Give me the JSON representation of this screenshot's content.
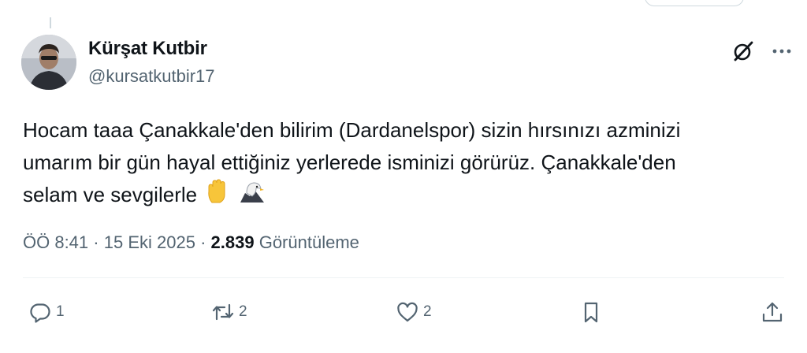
{
  "author": {
    "display_name": "Kürşat Kutbir",
    "handle": "@kursatkutbir17"
  },
  "tweet": {
    "lines": [
      "Hocam taaa Çanakkale'den bilirim (Dardanelspor) sizin hırsınızı azminizi",
      "umarım bir gün hayal ettiğiniz yerlerede isminizi görürüz. Çanakkale'den",
      "selam ve sevgilerle"
    ],
    "emojis": [
      "raised-hand-emoji",
      "eagle-emoji"
    ]
  },
  "meta": {
    "time": "ÖÖ 8:41",
    "separator": "·",
    "date": "15 Eki 2025",
    "views_count": "2.839",
    "views_label": "Görüntüleme"
  },
  "actions": {
    "reply_count": "1",
    "retweet_count": "2",
    "like_count": "2"
  },
  "icons": {
    "header": [
      "grok-icon",
      "more-icon"
    ],
    "actions": [
      "reply-icon",
      "retweet-icon",
      "like-icon",
      "bookmark-icon",
      "share-icon"
    ]
  },
  "colors": {
    "text": "#0f1419",
    "secondary": "#536471",
    "divider": "#eff3f4"
  }
}
